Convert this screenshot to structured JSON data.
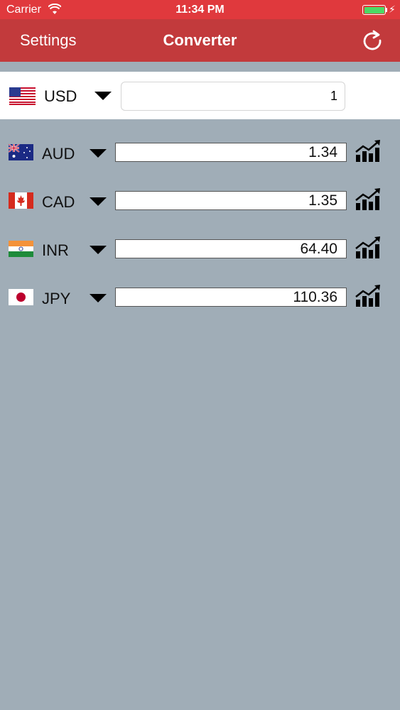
{
  "status_bar": {
    "carrier": "Carrier",
    "time": "11:34 PM",
    "icons": [
      "wifi-icon",
      "battery-icon",
      "charging-bolt-icon"
    ]
  },
  "nav": {
    "left_label": "Settings",
    "title": "Converter",
    "right_icon": "refresh-icon"
  },
  "base": {
    "code": "USD",
    "flag": "us-flag-icon",
    "amount": "1"
  },
  "rates": [
    {
      "code": "AUD",
      "value": "1.34",
      "flag": "australia-flag-icon"
    },
    {
      "code": "CAD",
      "value": "1.35",
      "flag": "canada-flag-icon"
    },
    {
      "code": "INR",
      "value": "64.40",
      "flag": "india-flag-icon"
    },
    {
      "code": "JPY",
      "value": "110.36",
      "flag": "japan-flag-icon"
    }
  ],
  "colors": {
    "status_bar": "#e0393d",
    "nav_bar": "#c23a3c",
    "background": "#a0adb7",
    "battery": "#4cd964"
  }
}
